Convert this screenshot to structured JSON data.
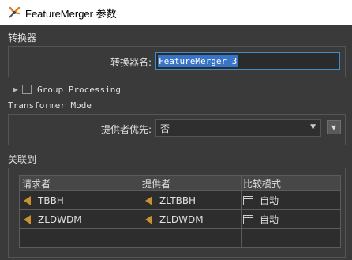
{
  "window": {
    "title": "FeatureMerger 参数"
  },
  "transformer_section": {
    "label": "转换器",
    "name_label": "转换器名:",
    "name_value": "FeatureMerger_3"
  },
  "group_processing": {
    "label": "Group Processing",
    "checked": false
  },
  "mode_section": {
    "label": "Transformer Mode",
    "supplier_priority_label": "提供者优先:",
    "supplier_priority_value": "否"
  },
  "join_section": {
    "label": "关联到",
    "columns": [
      "请求者",
      "提供者",
      "比较模式"
    ],
    "rows": [
      {
        "requestor": "TBBH",
        "supplier": "ZLTBBH",
        "mode": "自动"
      },
      {
        "requestor": "ZLDWDM",
        "supplier": "ZLDWDM",
        "mode": "自动"
      }
    ]
  },
  "colors": {
    "accent": "#3874c8",
    "arrow": "#c8922e",
    "background": "#3a3a3a"
  }
}
